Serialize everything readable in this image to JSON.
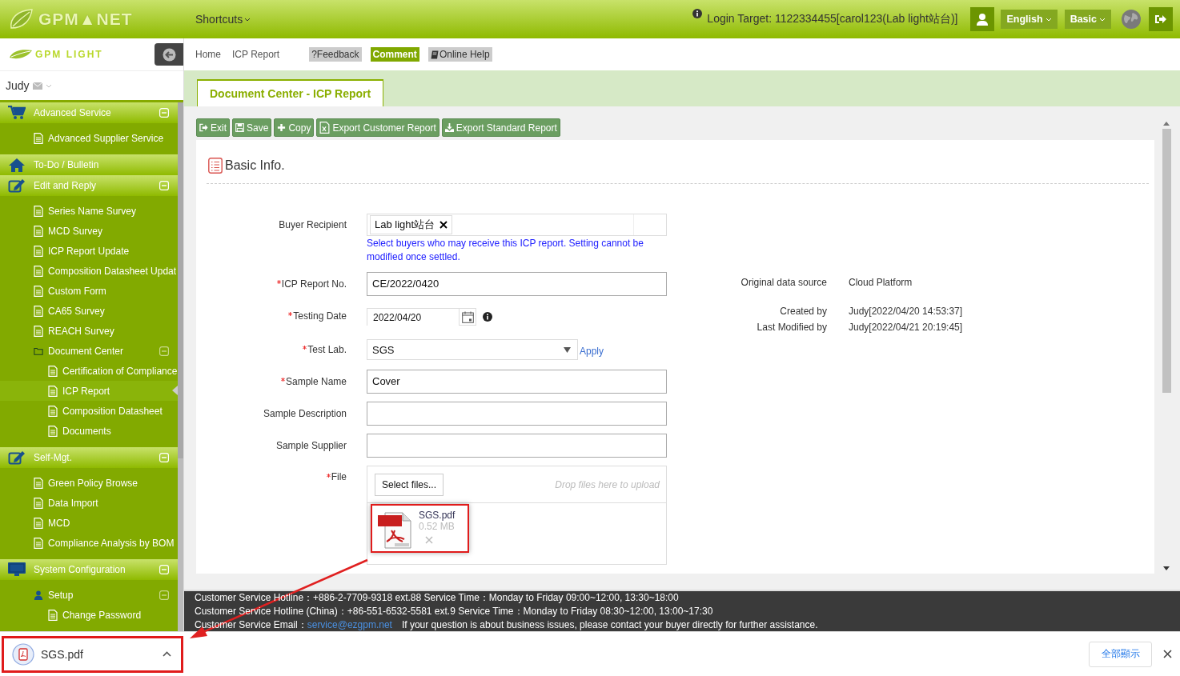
{
  "top_bar": {
    "logo": "GPM▲NET",
    "shortcuts": "Shortcuts",
    "login_target": "Login Target: 1122334455[carol123(Lab light站台)]",
    "language": "English",
    "plan": "Basic"
  },
  "sidebar": {
    "logo": "GPM LIGHT",
    "user": "Judy",
    "items": [
      {
        "label": "Advanced Service",
        "kind": "cart",
        "expanded": true,
        "children": [
          {
            "label": "Advanced Supplier Service",
            "kind": "doc",
            "selected": false
          }
        ]
      },
      {
        "label": "To-Do / Bulletin",
        "kind": "home",
        "selected": false
      },
      {
        "label": "Edit and Reply",
        "kind": "edit",
        "expanded": true,
        "children": [
          {
            "label": "Series Name Survey",
            "kind": "doc",
            "selected": false
          },
          {
            "label": "MCD Survey",
            "kind": "doc",
            "selected": false
          },
          {
            "label": "ICP Report Update",
            "kind": "doc",
            "selected": false
          },
          {
            "label": "Composition Datasheet Updat",
            "kind": "doc",
            "selected": false
          },
          {
            "label": "Custom Form",
            "kind": "doc",
            "selected": false
          },
          {
            "label": "CA65 Survey",
            "kind": "doc",
            "selected": false
          },
          {
            "label": "REACH Survey",
            "kind": "doc",
            "selected": false
          },
          {
            "label": "Document Center",
            "kind": "folder",
            "expanded": true,
            "children": [
              {
                "label": "Certification of Compliance",
                "kind": "doc",
                "selected": false
              },
              {
                "label": "ICP Report",
                "kind": "doc",
                "selected": true
              },
              {
                "label": "Composition Datasheet",
                "kind": "doc",
                "selected": false
              },
              {
                "label": "Documents",
                "kind": "doc",
                "selected": false
              }
            ]
          }
        ]
      },
      {
        "label": "Self-Mgt.",
        "kind": "edit",
        "expanded": true,
        "children": [
          {
            "label": "Green Policy Browse",
            "kind": "doc",
            "selected": false
          },
          {
            "label": "Data Import",
            "kind": "doc",
            "selected": false
          },
          {
            "label": "MCD",
            "kind": "doc",
            "selected": false
          },
          {
            "label": "Compliance Analysis by BOM",
            "kind": "doc",
            "selected": false
          }
        ]
      },
      {
        "label": "System Configuration",
        "kind": "monitor",
        "expanded": true,
        "children": [
          {
            "label": "Setup",
            "kind": "user",
            "expanded": true,
            "children": [
              {
                "label": "Change Password",
                "kind": "doc",
                "selected": false
              }
            ]
          }
        ]
      }
    ]
  },
  "breadcrumb": [
    "Home",
    "ICP Report"
  ],
  "help_buttons": [
    {
      "label": "?Feedback",
      "kind": "feedback"
    },
    {
      "label": "Comment",
      "kind": "comment"
    },
    {
      "label": "Online Help",
      "kind": "help"
    }
  ],
  "tabs": [
    {
      "label": "Document Center - ICP Report",
      "selected": true
    }
  ],
  "toolbar": [
    {
      "label": "Exit",
      "kind": "exit"
    },
    {
      "label": "Save",
      "kind": "save"
    },
    {
      "label": "Copy",
      "kind": "copy"
    },
    {
      "label": "Export Customer Report",
      "kind": "excel"
    },
    {
      "label": "Export Standard Report",
      "kind": "download"
    }
  ],
  "section": {
    "title": "Basic Info."
  },
  "form": [
    {
      "label": "Buyer Recipient",
      "required": false,
      "kind": "tags",
      "tags": [
        "Lab light站台"
      ],
      "help": "Select buyers who may receive this ICP report. Setting cannot be modified once settled."
    },
    {
      "label": "ICP Report No.",
      "required": true,
      "kind": "text",
      "value": "CE/2022/0420"
    },
    {
      "label": "Testing Date",
      "required": true,
      "kind": "date",
      "value": "2022/04/20"
    },
    {
      "label": "Test Lab.",
      "required": true,
      "kind": "select",
      "value": "SGS",
      "link": "Apply"
    },
    {
      "label": "Sample Name",
      "required": true,
      "kind": "text",
      "value": "Cover"
    },
    {
      "label": "Sample Description",
      "required": false,
      "kind": "text"
    },
    {
      "label": "Sample Supplier",
      "required": false,
      "kind": "text"
    },
    {
      "label": "File",
      "required": true,
      "kind": "upload",
      "button": "Select files...",
      "placeholder": "Drop files here to upload",
      "files": [
        {
          "name": "SGS.pdf",
          "size": "0.52 MB",
          "highlighted": true
        }
      ]
    }
  ],
  "info": [
    {
      "label": "Original data source",
      "value": "Cloud Platform"
    },
    {
      "label": "Created by",
      "value": "Judy[2022/04/20 14:53:37]"
    },
    {
      "label": "Last Modified by",
      "value": "Judy[2022/04/21 20:19:45]"
    }
  ],
  "footer": [
    {
      "text": "Customer Service Hotline：+886-2-7709-9318 ext.88 Service Time：Monday to Friday 09:00~12:00, 13:30~18:00"
    },
    {
      "text": "Customer Service Hotline (China)：+86-551-6532-5581 ext.9 Service Time：Monday to Friday 08:30~12:00, 13:00~17:30"
    },
    {
      "text": "Customer Service Email：",
      "link": "service@ezgpm.net",
      "note": "If your question is about business issues, please contact your buyer directly for further assistance."
    }
  ],
  "download_bar": {
    "items": [
      {
        "name": "SGS.pdf",
        "highlighted": true
      }
    ],
    "show_all": "全部顯示"
  }
}
